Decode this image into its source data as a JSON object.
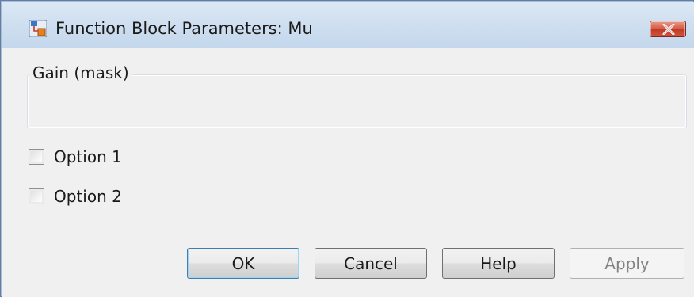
{
  "window": {
    "title": "Function Block Parameters: Mu",
    "icon": "simulink-block-icon",
    "close_icon": "close-icon"
  },
  "group": {
    "label": "Gain (mask)"
  },
  "options": [
    {
      "label": "Option 1",
      "checked": false
    },
    {
      "label": "Option 2",
      "checked": false
    }
  ],
  "buttons": {
    "ok": "OK",
    "cancel": "Cancel",
    "help": "Help",
    "apply": "Apply"
  },
  "colors": {
    "titlebar": "#cfdff0",
    "close_button": "#c94a36",
    "default_button_border": "#3c7fb1"
  }
}
